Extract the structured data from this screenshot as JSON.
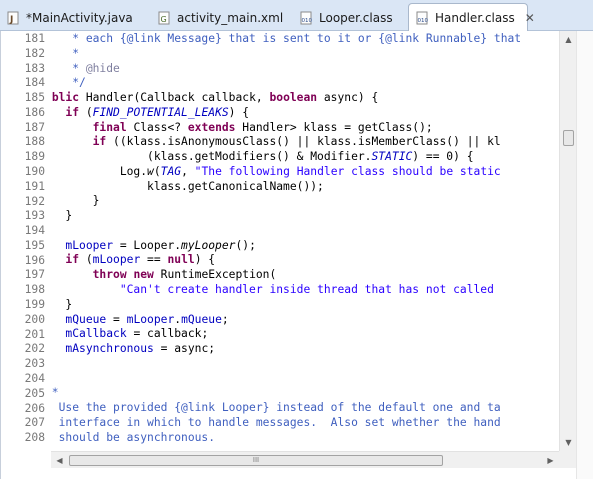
{
  "tabs": [
    {
      "label": "*MainActivity.java",
      "icon": "java-file-icon",
      "active": false
    },
    {
      "label": "activity_main.xml",
      "icon": "xml-file-icon",
      "active": false
    },
    {
      "label": "Looper.class",
      "icon": "class-file-icon",
      "active": false
    },
    {
      "label": "Handler.class",
      "icon": "class-file-icon",
      "active": true
    }
  ],
  "close_glyph": "✕",
  "colors": {
    "comment": "#3f5fbf",
    "keyword": "#7f0055",
    "string": "#2a00ff",
    "field": "#0000c0"
  },
  "code": {
    "line_numbers": [
      "181",
      "182",
      "183",
      "184",
      "185",
      "186",
      "187",
      "188",
      "189",
      "190",
      "191",
      "192",
      "193",
      "194",
      "195",
      "196",
      "197",
      "198",
      "199",
      "200",
      "201",
      "202",
      "203",
      "204",
      "205",
      "206",
      "207",
      "208"
    ],
    "lines": [
      [
        {
          "t": "         * each {@link Message} that is sent to it or {@link Runnable} that",
          "k": "com"
        }
      ],
      [
        {
          "t": "         *",
          "k": "com"
        }
      ],
      [
        {
          "t": "         * ",
          "k": "com"
        },
        {
          "t": "@hide",
          "k": "tag"
        }
      ],
      [
        {
          "t": "         */",
          "k": "com"
        }
      ],
      [
        {
          "t": "    ",
          "k": "tx"
        },
        {
          "t": "public",
          "k": "kw"
        },
        {
          "t": " Handler(Callback callback, ",
          "k": "tx"
        },
        {
          "t": "boolean",
          "k": "kw"
        },
        {
          "t": " async) {",
          "k": "tx"
        }
      ],
      [
        {
          "t": "        ",
          "k": "tx"
        },
        {
          "t": "if",
          "k": "kw"
        },
        {
          "t": " (",
          "k": "tx"
        },
        {
          "t": "FIND_POTENTIAL_LEAKS",
          "k": "sfi"
        },
        {
          "t": ") {",
          "k": "tx"
        }
      ],
      [
        {
          "t": "            ",
          "k": "tx"
        },
        {
          "t": "final",
          "k": "kw"
        },
        {
          "t": " Class<? ",
          "k": "tx"
        },
        {
          "t": "extends",
          "k": "kw"
        },
        {
          "t": " Handler> klass = getClass();",
          "k": "tx"
        }
      ],
      [
        {
          "t": "            ",
          "k": "tx"
        },
        {
          "t": "if",
          "k": "kw"
        },
        {
          "t": " ((klass.isAnonymousClass() || klass.isMemberClass() || kl",
          "k": "tx"
        }
      ],
      [
        {
          "t": "                    (klass.getModifiers() & Modifier.",
          "k": "tx"
        },
        {
          "t": "STATIC",
          "k": "sfi"
        },
        {
          "t": ") == 0) {",
          "k": "tx"
        }
      ],
      [
        {
          "t": "                Log.",
          "k": "tx"
        },
        {
          "t": "w",
          "k": "sm"
        },
        {
          "t": "(",
          "k": "tx"
        },
        {
          "t": "TAG",
          "k": "sfi"
        },
        {
          "t": ", ",
          "k": "tx"
        },
        {
          "t": "\"The following Handler class should be static",
          "k": "str"
        }
      ],
      [
        {
          "t": "                    klass.getCanonicalName());",
          "k": "tx"
        }
      ],
      [
        {
          "t": "            }",
          "k": "tx"
        }
      ],
      [
        {
          "t": "        }",
          "k": "tx"
        }
      ],
      [
        {
          "t": "",
          "k": "tx"
        }
      ],
      [
        {
          "t": "        ",
          "k": "tx"
        },
        {
          "t": "mLooper",
          "k": "fld"
        },
        {
          "t": " = Looper.",
          "k": "tx"
        },
        {
          "t": "myLooper",
          "k": "sm"
        },
        {
          "t": "();",
          "k": "tx"
        }
      ],
      [
        {
          "t": "        ",
          "k": "tx"
        },
        {
          "t": "if",
          "k": "kw"
        },
        {
          "t": " (",
          "k": "tx"
        },
        {
          "t": "mLooper",
          "k": "fld"
        },
        {
          "t": " == ",
          "k": "tx"
        },
        {
          "t": "null",
          "k": "kw"
        },
        {
          "t": ") {",
          "k": "tx"
        }
      ],
      [
        {
          "t": "            ",
          "k": "tx"
        },
        {
          "t": "throw",
          "k": "kw"
        },
        {
          "t": " ",
          "k": "tx"
        },
        {
          "t": "new",
          "k": "kw"
        },
        {
          "t": " RuntimeException(",
          "k": "tx"
        }
      ],
      [
        {
          "t": "                ",
          "k": "tx"
        },
        {
          "t": "\"Can't create handler inside thread that has not called",
          "k": "str"
        }
      ],
      [
        {
          "t": "        }",
          "k": "tx"
        }
      ],
      [
        {
          "t": "        ",
          "k": "tx"
        },
        {
          "t": "mQueue",
          "k": "fld"
        },
        {
          "t": " = ",
          "k": "tx"
        },
        {
          "t": "mLooper",
          "k": "fld"
        },
        {
          "t": ".",
          "k": "tx"
        },
        {
          "t": "mQueue",
          "k": "fld"
        },
        {
          "t": ";",
          "k": "tx"
        }
      ],
      [
        {
          "t": "        ",
          "k": "tx"
        },
        {
          "t": "mCallback",
          "k": "fld"
        },
        {
          "t": " = callback;",
          "k": "tx"
        }
      ],
      [
        {
          "t": "        ",
          "k": "tx"
        },
        {
          "t": "mAsynchronous",
          "k": "fld"
        },
        {
          "t": " = async;",
          "k": "tx"
        }
      ],
      [
        {
          "t": "    }",
          "k": "tx"
        }
      ],
      [
        {
          "t": "",
          "k": "tx"
        }
      ],
      [
        {
          "t": "    /**",
          "k": "com"
        }
      ],
      [
        {
          "t": "     * Use the provided {@link Looper} instead of the default one and ta",
          "k": "com"
        }
      ],
      [
        {
          "t": "     * interface in which to handle messages.  Also set whether the hand",
          "k": "com"
        }
      ],
      [
        {
          "t": "     * should be asynchronous.",
          "k": "com"
        }
      ]
    ]
  },
  "scrollbars": {
    "vertical_position": 0.22,
    "horizontal_thumb_grip": "III"
  }
}
